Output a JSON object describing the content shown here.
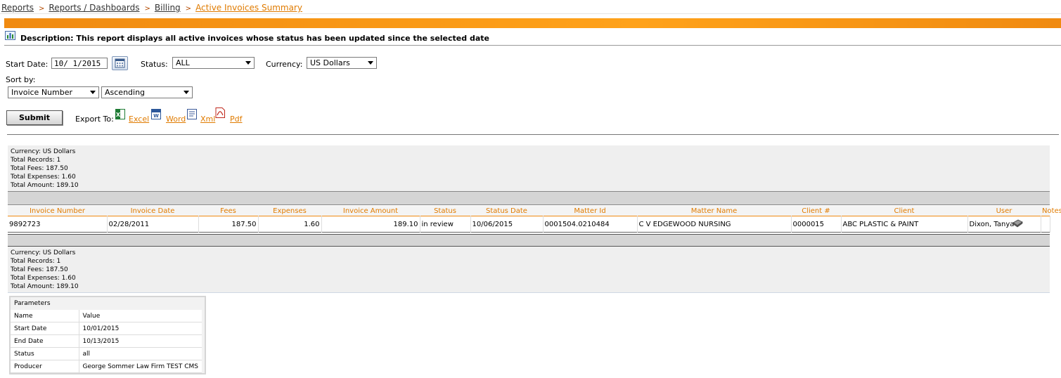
{
  "breadcrumb": [
    "Reports",
    "Reports / Dashboards",
    "Billing",
    "Active Invoices Summary"
  ],
  "description": "Description: This report displays all active invoices whose status has been updated since the selected date",
  "filters": {
    "start_date_label": "Start Date:",
    "start_date_value": "10/ 1/2015",
    "status_label": "Status:",
    "status_value": "ALL",
    "currency_label": "Currency:",
    "currency_value": "US Dollars",
    "sort_label": "Sort by:",
    "sort_field": "Invoice Number",
    "sort_order": "Ascending"
  },
  "actions": {
    "submit": "Submit",
    "export_label": "Export To:",
    "exports": [
      "Excel",
      "Word",
      "Xml",
      "Pdf"
    ]
  },
  "summary": {
    "currency": "Currency: US Dollars",
    "records": "Total Records: 1",
    "fees": "Total Fees: 187.50",
    "expenses": "Total Expenses: 1.60",
    "amount": "Total Amount: 189.10"
  },
  "table": {
    "headers": [
      "Invoice Number",
      "Invoice Date",
      "Fees",
      "Expenses",
      "Invoice Amount",
      "Status",
      "Status Date",
      "Matter Id",
      "Matter Name",
      "Client #",
      "Client",
      "User",
      "Notes"
    ],
    "rows": [
      [
        "9892723",
        "02/28/2011",
        "187.50",
        "1.60",
        "189.10",
        "in review",
        "10/06/2015",
        "0001504.0210484",
        "C V EDGEWOOD NURSING",
        "0000015",
        "ABC PLASTIC & PAINT",
        "Dixon, Tanya",
        ""
      ]
    ]
  },
  "parameters": {
    "title": "Parameters",
    "header": [
      "Name",
      "Value"
    ],
    "rows": [
      [
        "Start Date",
        "10/01/2015"
      ],
      [
        "End Date",
        "10/13/2015"
      ],
      [
        "Status",
        "all"
      ],
      [
        "Producer",
        "George Sommer Law Firm TEST CMS"
      ]
    ]
  },
  "icons": {
    "export": [
      "excel-icon",
      "word-icon",
      "xml-icon",
      "pdf-icon"
    ],
    "calendar": "calendar-icon",
    "notes": "notes-icon",
    "report": "report-chart-icon"
  },
  "colors": {
    "accent": "#e07b00",
    "banner": "#f8961a",
    "panel": "#efefef"
  }
}
